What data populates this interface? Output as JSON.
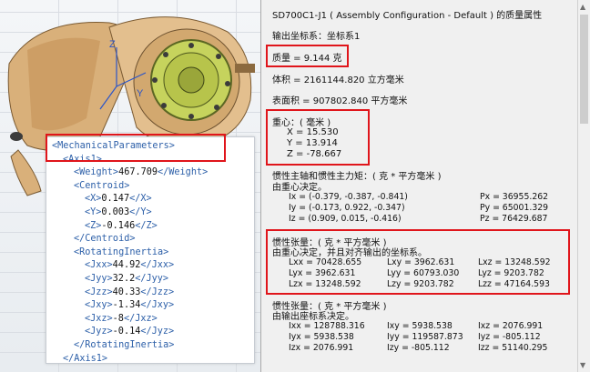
{
  "xml": {
    "lines": [
      "<MechanicalParameters>",
      "<Axis1>",
      "<Weight>467.709</Weight>",
      "<Centroid>",
      "<X>0.147</X>",
      "<Y>0.003</Y>",
      "<Z>-0.146</Z>",
      "</Centroid>",
      "<RotatingInertia>",
      "<Jxx>44.92</Jxx>",
      "<Jyy>32.2</Jyy>",
      "<Jzz>40.33</Jzz>",
      "<Jxy>-1.34</Jxy>",
      "<Jxz>-8</Jxz>",
      "<Jyz>-0.14</Jyz>",
      "</RotatingInertia>",
      "</Axis1>"
    ]
  },
  "axis_labels": {
    "z": "Z",
    "y": "Y"
  },
  "dialog": {
    "title": "SD700C1-J1 ( Assembly Configuration - Default ) 的质量属性",
    "coord_system": "输出坐标系：坐标系1",
    "mass": "质量 = 9.144 克",
    "volume": "体积 = 2161144.820 立方毫米",
    "surface_area": "表面积 = 907802.840 平方毫米",
    "cog_header": "重心：( 毫米 )",
    "cog_x": "X = 15.530",
    "cog_y": "Y = 13.914",
    "cog_z": "Z = -78.667",
    "principal_header": "惯性主轴和惯性主力矩：( 克 * 平方毫米 )",
    "principal_sub": "由重心决定。",
    "principal_axes": [
      {
        "axis": "Ix = (-0.379, -0.387, -0.841)",
        "moment": "Px = 36955.262"
      },
      {
        "axis": "Iy = (-0.173, 0.922, -0.347)",
        "moment": "Py = 65001.329"
      },
      {
        "axis": "Iz = (0.909, 0.015, -0.416)",
        "moment": "Pz = 76429.687"
      }
    ],
    "tensor_cog_header": "惯性张量：( 克 * 平方毫米 )",
    "tensor_cog_sub": "由重心决定，并且对齐输出的坐标系。",
    "tensor_cog": [
      [
        "Lxx = 70428.655",
        "Lxy = 3962.631",
        "Lxz = 13248.592"
      ],
      [
        "Lyx = 3962.631",
        "Lyy = 60793.030",
        "Lyz = 9203.782"
      ],
      [
        "Lzx = 13248.592",
        "Lzy = 9203.782",
        "Lzz = 47164.593"
      ]
    ],
    "tensor_out_header": "惯性张量：( 克 * 平方毫米 )",
    "tensor_out_sub": "由输出座标系决定。",
    "tensor_out": [
      [
        "Ixx = 128788.316",
        "Ixy = 5938.538",
        "Ixz = 2076.991"
      ],
      [
        "Iyx = 5938.538",
        "Iyy = 119587.873",
        "Iyz = -805.112"
      ],
      [
        "Izx = 2076.991",
        "Izy = -805.112",
        "Izz = 51140.295"
      ]
    ]
  }
}
